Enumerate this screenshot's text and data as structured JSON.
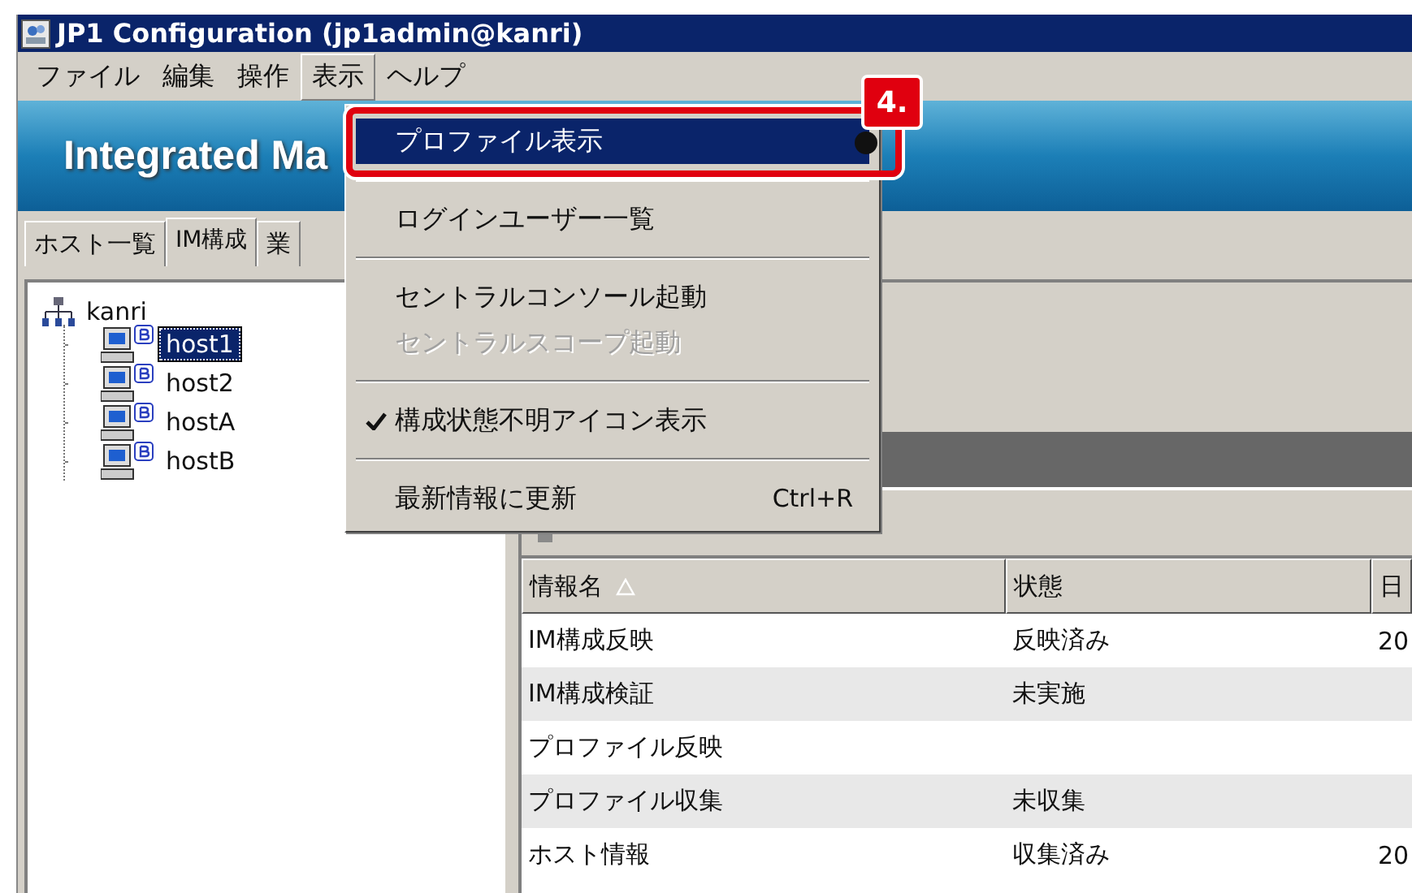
{
  "window": {
    "title": "JP1 Configuration (jp1admin@kanri)"
  },
  "menu_bar": [
    {
      "label": "ファイル",
      "selected": false
    },
    {
      "label": "編集",
      "selected": false
    },
    {
      "label": "操作",
      "selected": false
    },
    {
      "label": "表示",
      "selected": true
    },
    {
      "label": "ヘルプ",
      "selected": false
    }
  ],
  "banner": {
    "title": "Integrated Ma"
  },
  "tabs": [
    {
      "label": "ホスト一覧",
      "selected": false
    },
    {
      "label": "IM構成",
      "selected": true
    },
    {
      "label": "業",
      "selected": false
    }
  ],
  "tree": {
    "label": "kanri",
    "selected": false,
    "children": [
      {
        "label": "host1",
        "selected": true
      },
      {
        "label": "host2",
        "selected": false
      },
      {
        "label": "hostA",
        "selected": false
      },
      {
        "label": "hostB",
        "selected": false
      }
    ]
  },
  "table": {
    "columns": [
      {
        "label": "情報名",
        "sorted_ascending": true
      },
      {
        "label": "状態"
      },
      {
        "label": "日"
      }
    ],
    "rows": [
      {
        "name": "IM構成反映",
        "state": "反映済み",
        "date": "20"
      },
      {
        "name": "IM構成検証",
        "state": "未実施"
      },
      {
        "name": "プロファイル反映"
      },
      {
        "name": "プロファイル収集",
        "state": "未収集"
      },
      {
        "name": "ホスト情報",
        "state": "収集済み",
        "date": "20"
      }
    ]
  },
  "dropdown_menu": {
    "items": [
      {
        "kind": "item",
        "label": "プロファイル表示",
        "selected": true,
        "disabled": false,
        "checked": false
      },
      {
        "kind": "separator"
      },
      {
        "kind": "item",
        "label": "ログインユーザー一覧",
        "selected": false,
        "disabled": false,
        "checked": false
      },
      {
        "kind": "separator"
      },
      {
        "kind": "item",
        "label": "セントラルコンソール起動",
        "selected": false,
        "disabled": false,
        "checked": false
      },
      {
        "kind": "item",
        "label": "セントラルスコープ起動",
        "selected": false,
        "disabled": true,
        "checked": false
      },
      {
        "kind": "separator"
      },
      {
        "kind": "item",
        "label": "構成状態不明アイコン表示",
        "selected": false,
        "disabled": false,
        "checked": true
      },
      {
        "kind": "separator"
      },
      {
        "kind": "item",
        "label": "最新情報に更新",
        "shortcut": "Ctrl+R",
        "selected": false,
        "disabled": false,
        "checked": false
      }
    ],
    "callout": {
      "label": "4."
    }
  }
}
